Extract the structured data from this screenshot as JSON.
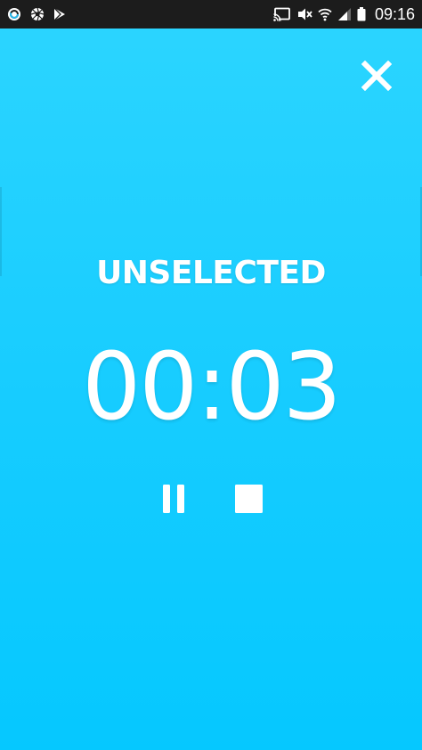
{
  "status_bar": {
    "time": "09:16",
    "left_icons": [
      "sync-circle-icon",
      "shutter-icon",
      "play-store-icon"
    ],
    "right_icons": [
      "cast-icon",
      "mute-icon",
      "wifi-icon",
      "signal-icon",
      "battery-icon"
    ]
  },
  "timer": {
    "tag_label": "UNSELECTED",
    "elapsed": "00:03"
  },
  "controls": {
    "close_icon": "close-icon",
    "pause_icon": "pause-icon",
    "stop_icon": "stop-icon"
  },
  "colors": {
    "background": "#16ccff",
    "foreground": "#ffffff",
    "status_bar": "#1c1c1c"
  }
}
